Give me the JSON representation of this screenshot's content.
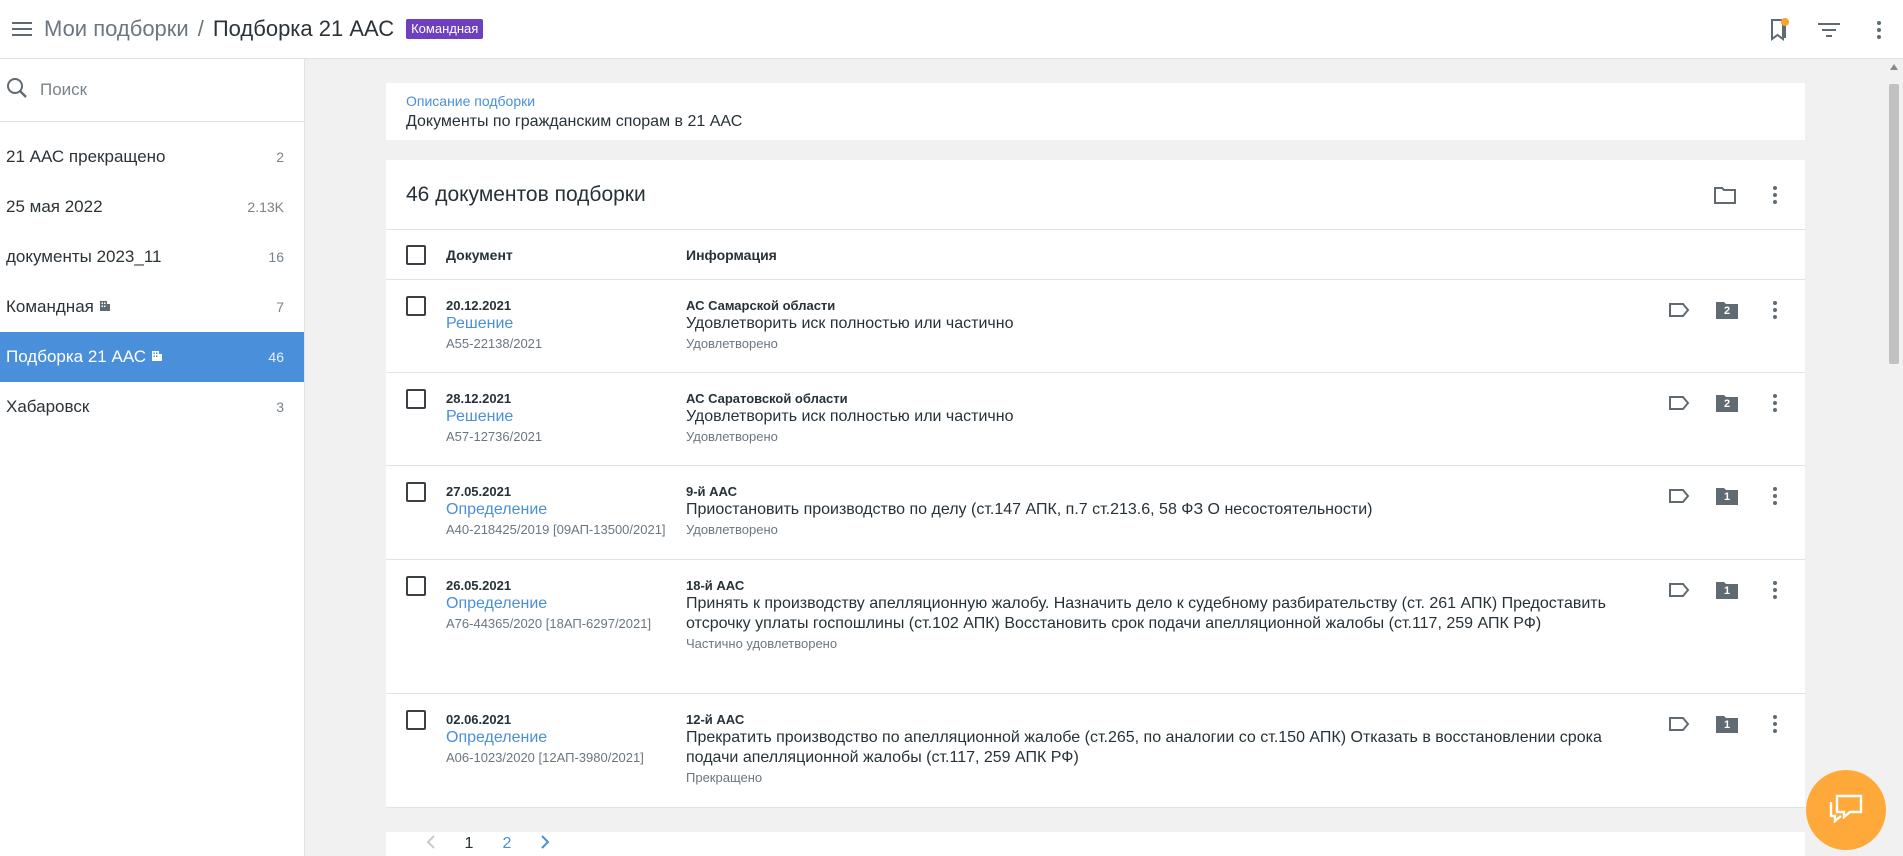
{
  "header": {
    "breadcrumb_parent": "Мои подборки",
    "separator": "/",
    "breadcrumb_current": "Подборка 21 ААС",
    "badge": "Командная",
    "icons": [
      "menu-icon",
      "bookmark-notification-icon",
      "filter-icon",
      "more-vert-icon"
    ],
    "accent_color": "#6e3fbf",
    "notification_color": "#ff9f2f"
  },
  "sidebar": {
    "search_placeholder": "Поиск",
    "items": [
      {
        "label": "21 ААС прекращено",
        "count": "2",
        "team": false,
        "active": false
      },
      {
        "label": "25 мая 2022",
        "count": "2.13K",
        "team": false,
        "active": false
      },
      {
        "label": "документы 2023_11",
        "count": "16",
        "team": false,
        "active": false
      },
      {
        "label": "Командная",
        "count": "7",
        "team": true,
        "active": false
      },
      {
        "label": "Подборка 21 ААС",
        "count": "46",
        "team": true,
        "active": true
      },
      {
        "label": "Хабаровск",
        "count": "3",
        "team": false,
        "active": false
      }
    ],
    "active_color": "#4a8fd9"
  },
  "description": {
    "label": "Описание подборки",
    "text": "Документы по гражданским спорам в 21 ААС"
  },
  "documents": {
    "title": "46 документов подборки",
    "columns": {
      "document": "Документ",
      "info": "Информация"
    },
    "rows": [
      {
        "date": "20.12.2021",
        "type": "Решение",
        "number": "А55-22138/2021",
        "court": "АС Самарской области",
        "result": "Удовлетворить иск полностью или частично",
        "status": "Удовлетворено",
        "folders": "2"
      },
      {
        "date": "28.12.2021",
        "type": "Решение",
        "number": "А57-12736/2021",
        "court": "АС Саратовской области",
        "result": "Удовлетворить иск полностью или частично",
        "status": "Удовлетворено",
        "folders": "2"
      },
      {
        "date": "27.05.2021",
        "type": "Определение",
        "number": "А40-218425/2019 [09АП-13500/2021]",
        "court": "9-й ААС",
        "result": "Приостановить производство по делу (ст.147 АПК, п.7 ст.213.6, 58 ФЗ О несостоятельности)",
        "status": "Удовлетворено",
        "folders": "1"
      },
      {
        "date": "26.05.2021",
        "type": "Определение",
        "number": "А76-44365/2020 [18АП-6297/2021]",
        "court": "18-й ААС",
        "result": "Принять к производству апелляционную жалобу. Назначить дело к судебному разбирательству (ст. 261 АПК) Предоставить отсрочку уплаты госпошлины (ст.102 АПК) Восстановить срок подачи апелляционной жалобы (ст.117, 259 АПК РФ)",
        "status": "Частично удовлетворено",
        "folders": "1"
      },
      {
        "date": "02.06.2021",
        "type": "Определение",
        "number": "А06-1023/2020 [12АП-3980/2021]",
        "court": "12-й ААС",
        "result": "Прекратить производство по апелляционной жалобе (ст.265, по аналогии со ст.150 АПК) Отказать в восстановлении срока подачи апелляционной жалобы (ст.117, 259 АПК РФ)",
        "status": "Прекращено",
        "folders": "1"
      }
    ]
  },
  "pagination": {
    "current": "1",
    "next_page": "2"
  },
  "chat": {
    "icon": "chat-icon",
    "color": "#ffa93a"
  }
}
